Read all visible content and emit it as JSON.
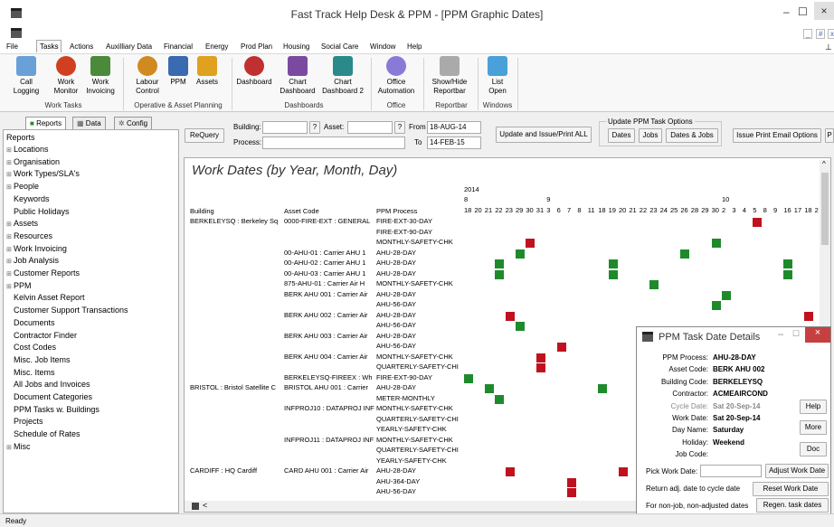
{
  "window": {
    "title": "Fast Track Help Desk & PPM - [PPM Graphic Dates]"
  },
  "menu": [
    "File",
    "Tasks",
    "Actions",
    "Auxilliary Data",
    "Financial",
    "Energy",
    "Prod Plan",
    "Housing",
    "Social Care",
    "Window",
    "Help"
  ],
  "ribbon": {
    "buttons": [
      {
        "label": "Call\nLogging",
        "icon": "call-logging-icon",
        "color": "#6aa0d8"
      },
      {
        "label": "Work\nMonitor",
        "icon": "work-monitor-icon",
        "color": "#d04020"
      },
      {
        "label": "Work\nInvoicing",
        "icon": "pound-icon",
        "color": "#4a8a3a"
      },
      {
        "label": "Labour\nControl",
        "icon": "clock-icon",
        "color": "#d08a20"
      },
      {
        "label": "PPM",
        "icon": "calendar-icon",
        "color": "#3a6ab0"
      },
      {
        "label": "Assets",
        "icon": "gear-icon",
        "color": "#e0a020"
      },
      {
        "label": "Dashboard",
        "icon": "pie-chart-icon",
        "color": "#c03030"
      },
      {
        "label": "Chart\nDashboard",
        "icon": "bar-chart-icon",
        "color": "#7a4aa0"
      },
      {
        "label": "Chart\nDashboard 2",
        "icon": "bar-chart-2-icon",
        "color": "#2a8a8a"
      },
      {
        "label": "Office\nAutomation",
        "icon": "bulb-icon",
        "color": "#8a7ad8"
      },
      {
        "label": "Show/Hide\nReportbar",
        "icon": "reportbar-icon",
        "color": "#aaaaaa"
      },
      {
        "label": "List\nOpen",
        "icon": "list-icon",
        "color": "#4aa0d8"
      }
    ],
    "groups": [
      "Work Tasks",
      "Operative & Asset Planning",
      "Dashboards",
      "Office",
      "Reportbar",
      "Windows"
    ]
  },
  "left": {
    "tabs": [
      "Reports",
      "Data",
      "Config"
    ],
    "tree_title": "Reports",
    "items": [
      {
        "label": "Locations",
        "exp": true
      },
      {
        "label": "Organisation",
        "exp": true
      },
      {
        "label": "Work Types/SLA's",
        "exp": true
      },
      {
        "label": "People",
        "exp": true
      },
      {
        "label": "Keywords",
        "exp": false
      },
      {
        "label": "Public Holidays",
        "exp": false
      },
      {
        "label": "Assets",
        "exp": true
      },
      {
        "label": "Resources",
        "exp": true
      },
      {
        "label": "Work Invoicing",
        "exp": true
      },
      {
        "label": "Job Analysis",
        "exp": true
      },
      {
        "label": "Customer Reports",
        "exp": true
      },
      {
        "label": "PPM",
        "exp": true
      },
      {
        "label": "Kelvin Asset Report",
        "exp": false
      },
      {
        "label": "Customer Support Transactions",
        "exp": false
      },
      {
        "label": "Documents",
        "exp": false
      },
      {
        "label": "Contractor Finder",
        "exp": false
      },
      {
        "label": "Cost Codes",
        "exp": false
      },
      {
        "label": "Misc. Job Items",
        "exp": false
      },
      {
        "label": "Misc. Items",
        "exp": false
      },
      {
        "label": "All Jobs and Invoices",
        "exp": false
      },
      {
        "label": "Document Categories",
        "exp": false
      },
      {
        "label": "PPM Tasks w. Buildings",
        "exp": false
      },
      {
        "label": "Projects",
        "exp": false
      },
      {
        "label": "Schedule of Rates",
        "exp": false
      },
      {
        "label": "Misc",
        "exp": true
      }
    ]
  },
  "toolbar": {
    "requery": "ReQuery",
    "building_label": "Building:",
    "asset_label": "Asset:",
    "process_label": "Process:",
    "from_label": "From",
    "to_label": "To",
    "from_value": "18-AUG-14",
    "to_value": "14-FEB-15",
    "q": "?",
    "update_all": "Update and Issue/Print ALL",
    "opts_title": "Update PPM Task Options",
    "opt_dates": "Dates",
    "opt_jobs": "Jobs",
    "opt_dates_jobs": "Dates & Jobs",
    "issue_email": "Issue Print Email Options",
    "cut": "P"
  },
  "report": {
    "title": "Work Dates (by Year, Month, Day)",
    "year": "2014",
    "months": [
      "8",
      "9",
      "10"
    ],
    "days": [
      "18",
      "20",
      "21",
      "22",
      "23",
      "29",
      "30",
      "31",
      "3",
      "6",
      "7",
      "8",
      "11",
      "18",
      "19",
      "20",
      "21",
      "22",
      "23",
      "24",
      "25",
      "26",
      "28",
      "29",
      "30",
      "2",
      "3",
      "4",
      "5",
      "8",
      "9",
      "16",
      "17",
      "18",
      "2"
    ],
    "col_headers": [
      "Building",
      "Asset Code",
      "PPM Process"
    ],
    "rows": [
      {
        "b": "BERKELEYSQ : Berkeley Sq",
        "a": "0000-FIRE-EXT : GENERAL",
        "p": "FIRE-EXT-30-DAY",
        "m": [
          [
            28,
            "red"
          ]
        ]
      },
      {
        "b": "",
        "a": "",
        "p": "FIRE-EXT-90-DAY",
        "m": []
      },
      {
        "b": "",
        "a": "",
        "p": "MONTHLY-SAFETY-CHK",
        "m": [
          [
            6,
            "red"
          ],
          [
            24,
            "green"
          ]
        ]
      },
      {
        "b": "",
        "a": "00-AHU-01 : Carrier AHU 1",
        "p": "AHU-28-DAY",
        "m": [
          [
            5,
            "green"
          ],
          [
            21,
            "green"
          ]
        ]
      },
      {
        "b": "",
        "a": "00-AHU-02 : Carrier AHU 1",
        "p": "AHU-28-DAY",
        "m": [
          [
            3,
            "green"
          ],
          [
            14,
            "green"
          ],
          [
            31,
            "green"
          ]
        ]
      },
      {
        "b": "",
        "a": "00-AHU-03 : Carrier AHU 1",
        "p": "AHU-28-DAY",
        "m": [
          [
            3,
            "green"
          ],
          [
            14,
            "green"
          ],
          [
            31,
            "green"
          ]
        ]
      },
      {
        "b": "",
        "a": "875-AHU-01 : Carrier Air H",
        "p": "MONTHLY-SAFETY-CHK",
        "m": [
          [
            18,
            "green"
          ]
        ]
      },
      {
        "b": "",
        "a": "BERK AHU 001 : Carrier Air",
        "p": "AHU-28-DAY",
        "m": [
          [
            25,
            "green"
          ]
        ]
      },
      {
        "b": "",
        "a": "",
        "p": "AHU-56-DAY",
        "m": [
          [
            24,
            "green"
          ]
        ]
      },
      {
        "b": "",
        "a": "BERK AHU 002 : Carrier Air",
        "p": "AHU-28-DAY",
        "m": [
          [
            4,
            "red"
          ],
          [
            33,
            "red"
          ]
        ]
      },
      {
        "b": "",
        "a": "",
        "p": "AHU-56-DAY",
        "m": [
          [
            5,
            "green"
          ]
        ]
      },
      {
        "b": "",
        "a": "BERK AHU 003 : Carrier Air",
        "p": "AHU-28-DAY",
        "m": []
      },
      {
        "b": "",
        "a": "",
        "p": "AHU-56-DAY",
        "m": [
          [
            9,
            "red"
          ]
        ]
      },
      {
        "b": "",
        "a": "BERK AHU 004 : Carrier Air",
        "p": "MONTHLY-SAFETY-CHK",
        "m": [
          [
            7,
            "red"
          ]
        ]
      },
      {
        "b": "",
        "a": "",
        "p": "QUARTERLY-SAFETY-CHI",
        "m": [
          [
            7,
            "red"
          ]
        ]
      },
      {
        "b": "",
        "a": "BERKELEYSQ-FIREEX : Wh",
        "p": "FIRE-EXT-90-DAY",
        "m": [
          [
            0,
            "green"
          ]
        ]
      },
      {
        "b": "BRISTOL : Bristol Satellite C",
        "a": "BRISTOL AHU 001 : Carrier",
        "p": "AHU-28-DAY",
        "m": [
          [
            2,
            "green"
          ],
          [
            13,
            "green"
          ]
        ]
      },
      {
        "b": "",
        "a": "",
        "p": "METER-MONTHLY",
        "m": [
          [
            3,
            "green"
          ]
        ]
      },
      {
        "b": "",
        "a": "INFPROJ10 : DATAPROJ INF",
        "p": "MONTHLY-SAFETY-CHK",
        "m": []
      },
      {
        "b": "",
        "a": "",
        "p": "QUARTERLY-SAFETY-CHI",
        "m": []
      },
      {
        "b": "",
        "a": "",
        "p": "YEARLY-SAFETY-CHK",
        "m": []
      },
      {
        "b": "",
        "a": "INFPROJ11 : DATAPROJ INF",
        "p": "MONTHLY-SAFETY-CHK",
        "m": []
      },
      {
        "b": "",
        "a": "",
        "p": "QUARTERLY-SAFETY-CHI",
        "m": []
      },
      {
        "b": "",
        "a": "",
        "p": "YEARLY-SAFETY-CHK",
        "m": []
      },
      {
        "b": "CARDIFF : HQ Cardiff",
        "a": "CARD AHU 001 : Carrier Air",
        "p": "AHU-28-DAY",
        "m": [
          [
            4,
            "red"
          ],
          [
            15,
            "red"
          ]
        ]
      },
      {
        "b": "",
        "a": "",
        "p": "AHU-364-DAY",
        "m": [
          [
            10,
            "red"
          ]
        ]
      },
      {
        "b": "",
        "a": "",
        "p": "AHU-56-DAY",
        "m": [
          [
            10,
            "red"
          ]
        ]
      }
    ]
  },
  "dialog": {
    "title": "PPM Task Date Details",
    "fields": [
      {
        "k": "PPM Process:",
        "v": "AHU-28-DAY",
        "dim": false
      },
      {
        "k": "Asset Code:",
        "v": "BERK AHU 002",
        "dim": false
      },
      {
        "k": "Building Code:",
        "v": "BERKELEYSQ",
        "dim": false
      },
      {
        "k": "Contractor:",
        "v": "ACMEAIRCOND",
        "dim": false
      },
      {
        "k": "Cycle Date:",
        "v": "Sat 20-Sep-14",
        "dim": true
      },
      {
        "k": "Work Date:",
        "v": "Sat 20-Sep-14",
        "dim": false
      },
      {
        "k": "Day Name:",
        "v": "Saturday",
        "dim": false
      },
      {
        "k": "Holiday:",
        "v": "Weekend",
        "dim": false
      },
      {
        "k": "Job Code:",
        "v": "",
        "dim": false
      }
    ],
    "help": "Help",
    "more": "More",
    "doc": "Doc",
    "pick_label": "Pick Work Date:",
    "adjust": "Adjust Work Date",
    "return_label": "Return adj. date to cycle date",
    "reset": "Reset Work Date",
    "nonjob_label": "For non-job, non-adjusted dates",
    "regen": "Regen. task dates"
  },
  "status": "Ready"
}
